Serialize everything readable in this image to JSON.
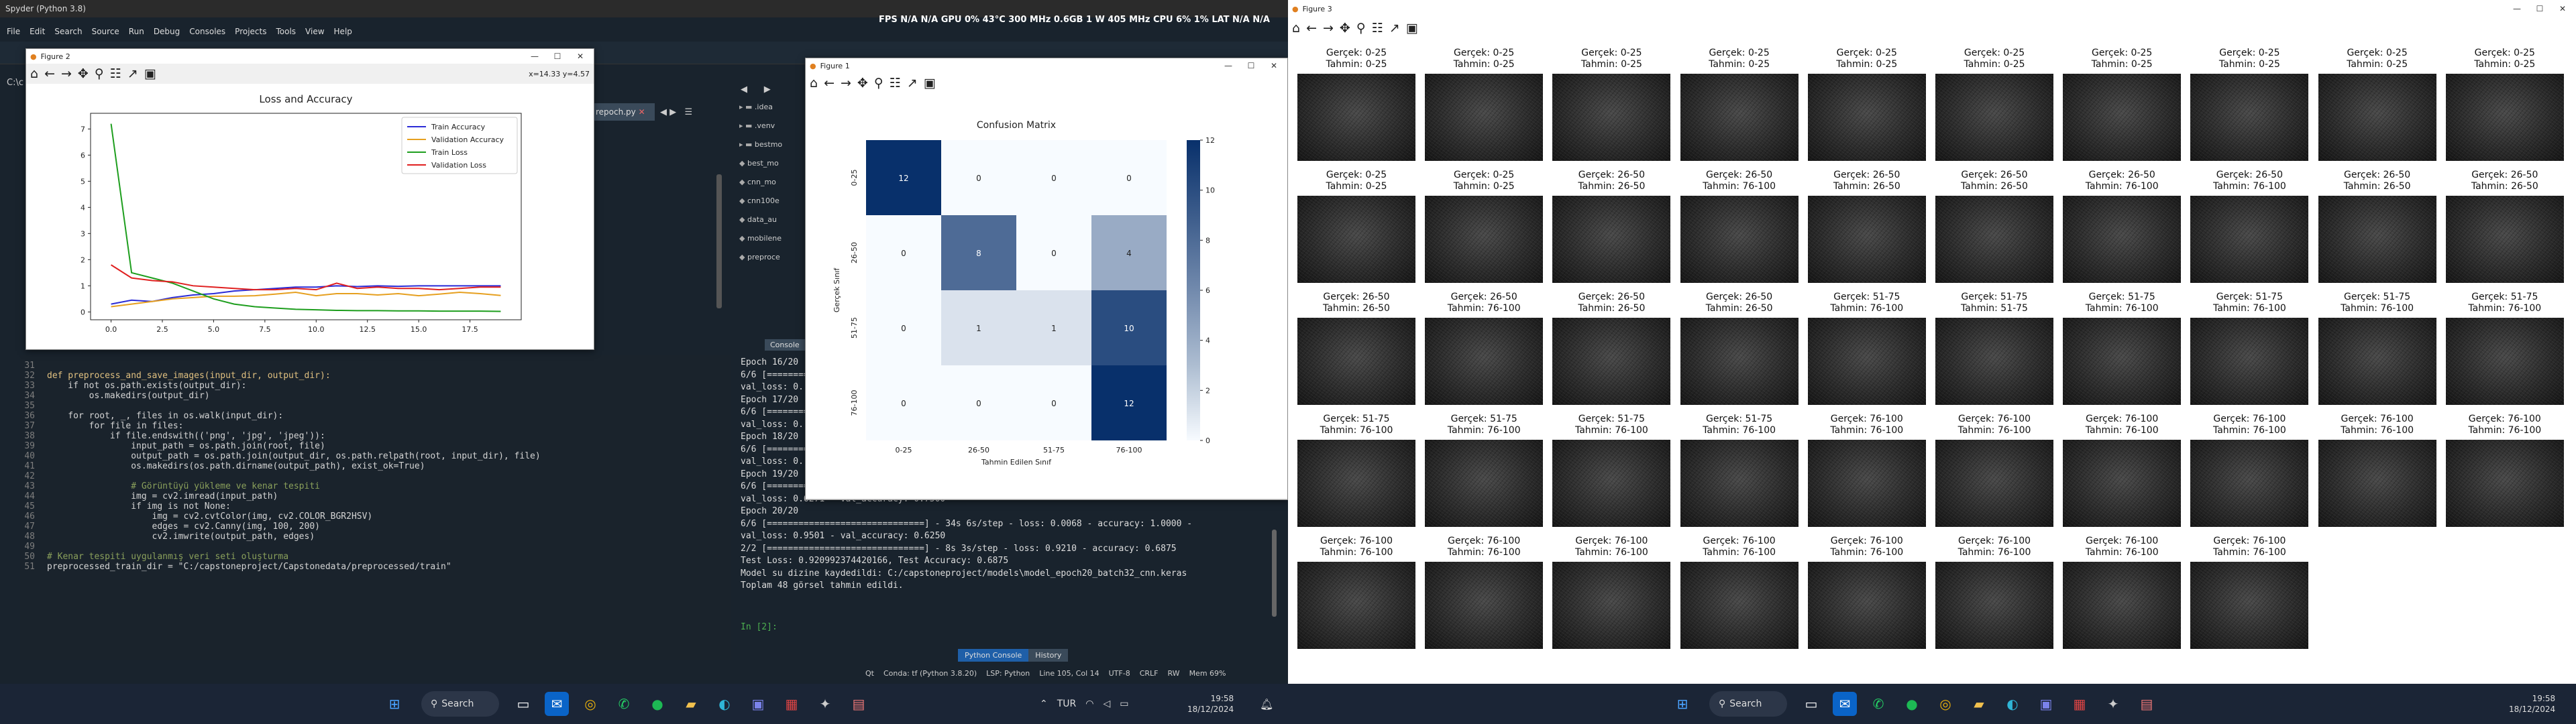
{
  "spyder": {
    "title": "Spyder (Python 3.8)",
    "menu": [
      "File",
      "Edit",
      "Search",
      "Source",
      "Run",
      "Debug",
      "Consoles",
      "Projects",
      "Tools",
      "View",
      "Help"
    ],
    "status_top": "FPS N/A N/A GPU 0% 43°C 300 MHz 0.6GB 1 W 405 MHz CPU 6% 1% LAT N/A N/A",
    "path_stub": "C:\\c",
    "editor_tab": "repoch.py",
    "files": [
      ".idea",
      ".venv",
      "bestmo",
      "best_mo",
      "cnn_mo",
      "cnn100e",
      "data_au",
      "mobilene",
      "preproce"
    ],
    "console_tab": "Console",
    "console_lines": [
      "Epoch 16/20",
      "6/6 [========",
      "val_loss: 0.",
      "Epoch 17/20",
      "6/6 [========",
      "val_loss: 0.",
      "Epoch 18/20",
      "6/6 [========",
      "val_loss: 0.",
      "Epoch 19/20",
      "6/6 [==============================] - 35s 6s/step - loss: 0.0061 - accuracy: 1.0000 -",
      "val_loss: 0.6271 - val_accuracy: 0.7500",
      "Epoch 20/20",
      "6/6 [==============================] - 34s 6s/step - loss: 0.0068 - accuracy: 1.0000 -",
      "val_loss: 0.9501 - val_accuracy: 0.6250",
      "2/2 [==============================] - 8s 3s/step - loss: 0.9210 - accuracy: 0.6875",
      "Test Loss: 0.920992374420166, Test Accuracy: 0.6875",
      "Model su dizine kaydedildi: C:/capstoneproject/models\\model_epoch20_batch32_cnn.keras",
      "Toplam 48 görsel tahmin edildi."
    ],
    "prompt": "In [2]:",
    "bottom_tabs": [
      "Python Console",
      "History"
    ],
    "statusbar": [
      "Qt",
      "Conda: tf (Python 3.8.20)",
      "LSP: Python",
      "Line 105, Col 14",
      "UTF-8",
      "CRLF",
      "RW",
      "Mem 69%"
    ],
    "code": [
      [
        "31",
        ""
      ],
      [
        "32",
        "def preprocess_and_save_images(input_dir, output_dir):"
      ],
      [
        "33",
        "    if not os.path.exists(output_dir):"
      ],
      [
        "34",
        "        os.makedirs(output_dir)"
      ],
      [
        "35",
        ""
      ],
      [
        "36",
        "    for root, _, files in os.walk(input_dir):"
      ],
      [
        "37",
        "        for file in files:"
      ],
      [
        "38",
        "            if file.endswith(('png', 'jpg', 'jpeg')):"
      ],
      [
        "39",
        "                input_path = os.path.join(root, file)"
      ],
      [
        "40",
        "                output_path = os.path.join(output_dir, os.path.relpath(root, input_dir), file)"
      ],
      [
        "41",
        "                os.makedirs(os.path.dirname(output_path), exist_ok=True)"
      ],
      [
        "42",
        ""
      ],
      [
        "43",
        "                # Görüntüyü yükleme ve kenar tespiti"
      ],
      [
        "44",
        "                img = cv2.imread(input_path)"
      ],
      [
        "45",
        "                if img is not None:"
      ],
      [
        "46",
        "                    img = cv2.cvtColor(img, cv2.COLOR_BGR2HSV)"
      ],
      [
        "47",
        "                    edges = cv2.Canny(img, 100, 200)"
      ],
      [
        "48",
        "                    cv2.imwrite(output_path, edges)"
      ],
      [
        "49",
        ""
      ],
      [
        "50",
        "# Kenar tespiti uygulanmış veri seti oluşturma"
      ],
      [
        "51",
        "preprocessed_train_dir = \"C:/capstoneproject/Capstonedata/preprocessed/train\""
      ]
    ]
  },
  "fig2": {
    "title": "Figure 2",
    "coords": "x=14.33 y=4.57"
  },
  "fig1": {
    "title": "Figure 1"
  },
  "fig3": {
    "title": "Figure 3"
  },
  "chart_data": [
    {
      "type": "line",
      "title": "Loss and Accuracy",
      "x": [
        0,
        1,
        2,
        3,
        4,
        5,
        6,
        7,
        8,
        9,
        10,
        11,
        12,
        13,
        14,
        15,
        16,
        17,
        18,
        19
      ],
      "xticks": [
        "0.0",
        "2.5",
        "5.0",
        "7.5",
        "10.0",
        "12.5",
        "15.0",
        "17.5"
      ],
      "yticks": [
        "0",
        "1",
        "2",
        "3",
        "4",
        "5",
        "6",
        "7"
      ],
      "xlim": [
        -1,
        20
      ],
      "ylim": [
        -0.3,
        7.6
      ],
      "legend": "top-right",
      "series": [
        {
          "name": "Train Accuracy",
          "color": "#2b2bd6",
          "values": [
            0.3,
            0.45,
            0.4,
            0.55,
            0.65,
            0.7,
            0.8,
            0.85,
            0.9,
            0.95,
            0.95,
            1.0,
            0.97,
            1.0,
            0.98,
            1.0,
            1.0,
            1.0,
            1.0,
            1.0
          ]
        },
        {
          "name": "Validation Accuracy",
          "color": "#e6a020",
          "values": [
            0.2,
            0.3,
            0.4,
            0.5,
            0.55,
            0.6,
            0.6,
            0.62,
            0.68,
            0.75,
            0.62,
            0.7,
            0.7,
            0.65,
            0.7,
            0.62,
            0.68,
            0.75,
            0.7,
            0.63
          ]
        },
        {
          "name": "Train Loss",
          "color": "#1e9e1e",
          "values": [
            7.2,
            1.5,
            1.3,
            1.1,
            0.8,
            0.5,
            0.3,
            0.2,
            0.15,
            0.1,
            0.08,
            0.06,
            0.05,
            0.05,
            0.04,
            0.04,
            0.03,
            0.03,
            0.03,
            0.02
          ]
        },
        {
          "name": "Validation Loss",
          "color": "#e02020",
          "values": [
            1.8,
            1.3,
            1.2,
            1.15,
            1.0,
            0.95,
            0.9,
            0.85,
            0.85,
            0.9,
            0.85,
            1.1,
            0.9,
            0.95,
            0.9,
            0.9,
            0.85,
            0.9,
            0.95,
            0.95
          ]
        }
      ]
    },
    {
      "type": "heatmap",
      "title": "Confusion Matrix",
      "xlabel": "Tahmin Edilen Sınıf",
      "ylabel": "Gerçek Sınıf",
      "labels": [
        "0-25",
        "26-50",
        "51-75",
        "76-100"
      ],
      "values": [
        [
          12,
          0,
          0,
          0
        ],
        [
          0,
          8,
          0,
          4
        ],
        [
          0,
          1,
          1,
          10
        ],
        [
          0,
          0,
          0,
          12
        ]
      ],
      "colorbar_ticks": [
        "0",
        "2",
        "4",
        "6",
        "8",
        "10",
        "12"
      ]
    }
  ],
  "grid": {
    "items": [
      [
        "0-25",
        "0-25"
      ],
      [
        "0-25",
        "0-25"
      ],
      [
        "0-25",
        "0-25"
      ],
      [
        "0-25",
        "0-25"
      ],
      [
        "0-25",
        "0-25"
      ],
      [
        "0-25",
        "0-25"
      ],
      [
        "0-25",
        "0-25"
      ],
      [
        "0-25",
        "0-25"
      ],
      [
        "0-25",
        "0-25"
      ],
      [
        "0-25",
        "0-25"
      ],
      [
        "0-25",
        "0-25"
      ],
      [
        "0-25",
        "0-25"
      ],
      [
        "26-50",
        "26-50"
      ],
      [
        "26-50",
        "76-100"
      ],
      [
        "26-50",
        "26-50"
      ],
      [
        "26-50",
        "26-50"
      ],
      [
        "26-50",
        "76-100"
      ],
      [
        "26-50",
        "76-100"
      ],
      [
        "26-50",
        "26-50"
      ],
      [
        "26-50",
        "26-50"
      ],
      [
        "26-50",
        "26-50"
      ],
      [
        "26-50",
        "76-100"
      ],
      [
        "26-50",
        "26-50"
      ],
      [
        "26-50",
        "26-50"
      ],
      [
        "51-75",
        "76-100"
      ],
      [
        "51-75",
        "51-75"
      ],
      [
        "51-75",
        "76-100"
      ],
      [
        "51-75",
        "76-100"
      ],
      [
        "51-75",
        "76-100"
      ],
      [
        "51-75",
        "76-100"
      ],
      [
        "51-75",
        "76-100"
      ],
      [
        "51-75",
        "76-100"
      ],
      [
        "51-75",
        "76-100"
      ],
      [
        "51-75",
        "76-100"
      ],
      [
        "76-100",
        "76-100"
      ],
      [
        "76-100",
        "76-100"
      ],
      [
        "76-100",
        "76-100"
      ],
      [
        "76-100",
        "76-100"
      ],
      [
        "76-100",
        "76-100"
      ],
      [
        "76-100",
        "76-100"
      ],
      [
        "76-100",
        "76-100"
      ],
      [
        "76-100",
        "76-100"
      ],
      [
        "76-100",
        "76-100"
      ],
      [
        "76-100",
        "76-100"
      ],
      [
        "76-100",
        "76-100"
      ],
      [
        "76-100",
        "76-100"
      ],
      [
        "76-100",
        "76-100"
      ],
      [
        "76-100",
        "76-100"
      ]
    ],
    "cap_true": "Gerçek: ",
    "cap_pred": "Tahmin: "
  },
  "taskbar": {
    "search": "Search",
    "lang": "TUR",
    "time": "19:58",
    "date": "18/12/2024"
  }
}
